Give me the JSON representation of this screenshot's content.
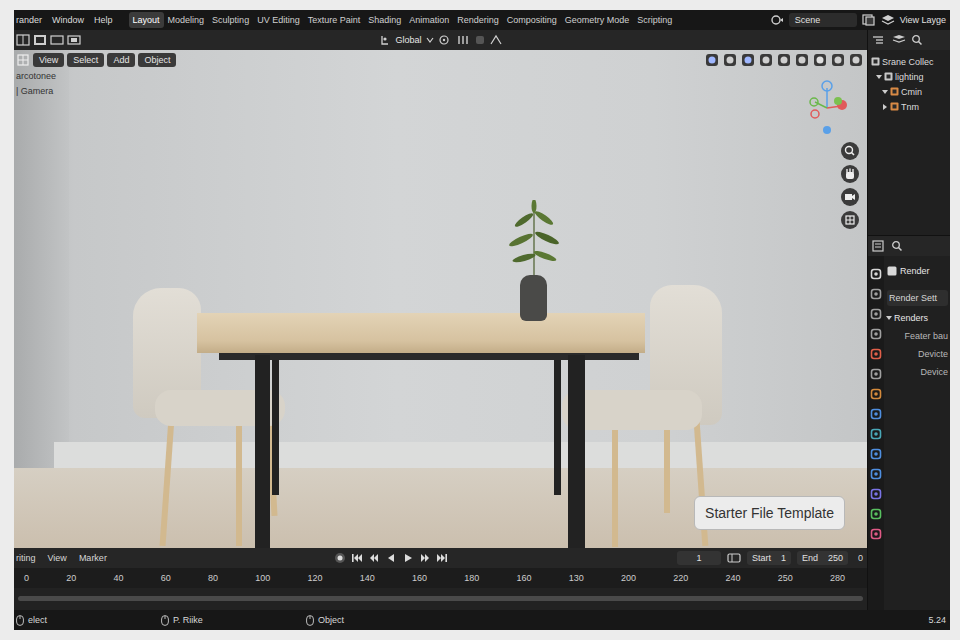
{
  "top_bar": {
    "menus": [
      "rander",
      "Window",
      "Help"
    ],
    "workspaces": [
      {
        "label": "Layout",
        "selected": true
      },
      {
        "label": "Modeling",
        "selected": false
      },
      {
        "label": "Sculpting",
        "selected": false
      },
      {
        "label": "UV Editing",
        "selected": false
      },
      {
        "label": "Texture Paint",
        "selected": false
      },
      {
        "label": "Shading",
        "selected": false
      },
      {
        "label": "Animation",
        "selected": false
      },
      {
        "label": "Rendering",
        "selected": false
      },
      {
        "label": "Compositing",
        "selected": false
      },
      {
        "label": "Geometry Mode",
        "selected": false
      },
      {
        "label": "Scripting",
        "selected": false
      }
    ],
    "scene": "Scene",
    "view_layer": "View Layge"
  },
  "toolbar": {
    "orientation": "Global"
  },
  "viewport": {
    "menus": [
      "View",
      "Select",
      "Add",
      "Object"
    ],
    "overlay_text": [
      "arcotonee",
      "| Gamera"
    ],
    "badge": "Starter File Template"
  },
  "outliner": {
    "items": [
      {
        "label": "Srane Collec",
        "children": [
          {
            "label": "lighting",
            "expanded": true,
            "children": [
              {
                "label": "Cmin",
                "expanded": true
              },
              {
                "label": "Tnm",
                "expanded": false
              }
            ]
          }
        ]
      }
    ]
  },
  "properties": {
    "title": "Render",
    "rows": [
      {
        "label": "Render Sett",
        "kind": "field"
      },
      {
        "label": "Renders",
        "kind": "section",
        "expanded": true
      },
      {
        "label": "Feater bau",
        "kind": "label"
      },
      {
        "label": "Devicte",
        "kind": "label"
      },
      {
        "label": "Device",
        "kind": "label"
      }
    ]
  },
  "timeline": {
    "menus": [
      "riting",
      "View",
      "Marker"
    ],
    "frame": "1",
    "start_label": "Start",
    "start": "1",
    "end_label": "End",
    "end": "250",
    "extra": "0",
    "ticks": [
      "0",
      "20",
      "40",
      "60",
      "80",
      "100",
      "120",
      "140",
      "160",
      "180",
      "160",
      "130",
      "200",
      "220",
      "240",
      "250",
      "280"
    ]
  },
  "status_bar": {
    "items": [
      "elect",
      "P. Riike",
      "Object"
    ],
    "version": "5.24"
  }
}
